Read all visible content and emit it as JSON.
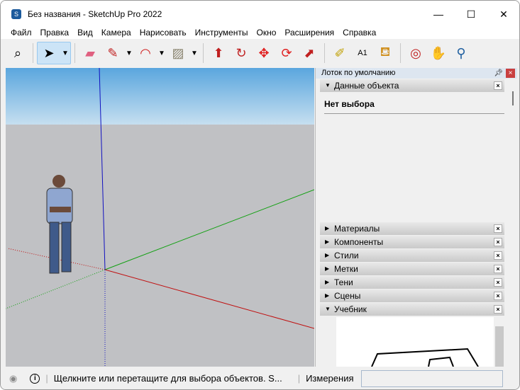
{
  "window": {
    "title": "Без названия - SketchUp Pro 2022",
    "minimize": "—",
    "maximize": "☐",
    "close": "✕"
  },
  "menu": [
    "Файл",
    "Правка",
    "Вид",
    "Камера",
    "Нарисовать",
    "Инструменты",
    "Окно",
    "Расширения",
    "Справка"
  ],
  "panel": {
    "title": "Лоток по умолчанию",
    "entity_info": "Данные объекта",
    "no_selection": "Нет выбора",
    "sections": [
      "Материалы",
      "Компоненты",
      "Стили",
      "Метки",
      "Тени",
      "Сцены"
    ],
    "tutorial": "Учебник"
  },
  "status": {
    "hint": "Щелкните или перетащите для выбора объектов. S...",
    "measurements_label": "Измерения",
    "measurements_value": ""
  }
}
